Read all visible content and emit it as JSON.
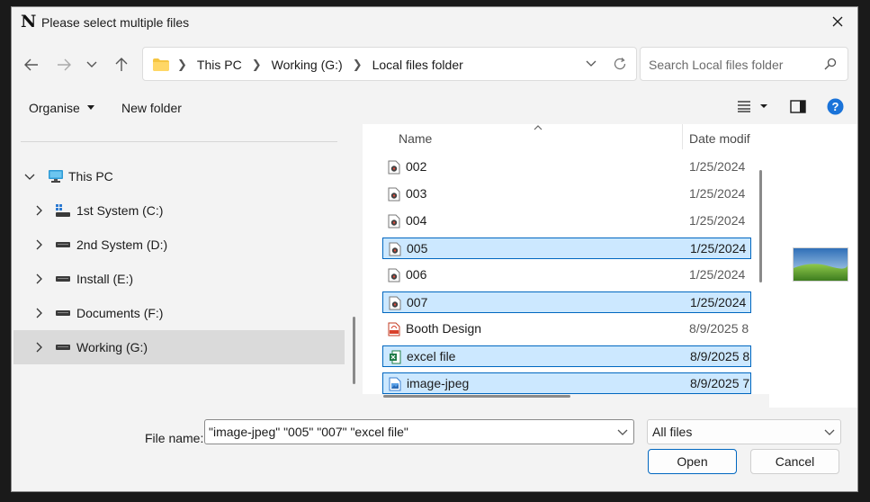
{
  "window": {
    "title": "Please select multiple files",
    "app_icon_glyph": "N"
  },
  "address": {
    "crumbs": [
      "This PC",
      "Working (G:)",
      "Local files folder"
    ]
  },
  "search": {
    "placeholder": "Search Local files folder"
  },
  "toolbar": {
    "organise_label": "Organise",
    "new_folder_label": "New folder",
    "help_glyph": "?"
  },
  "nav": {
    "items": [
      {
        "label": "This PC"
      },
      {
        "label": "1st System (C:)"
      },
      {
        "label": "2nd System (D:)"
      },
      {
        "label": "Install (E:)"
      },
      {
        "label": "Documents (F:)"
      },
      {
        "label": "Working (G:)"
      }
    ]
  },
  "files": {
    "col_name": "Name",
    "col_date": "Date modif",
    "rows": [
      {
        "name": "002",
        "date": "1/25/2024",
        "icon": "video-file-icon",
        "selected": false
      },
      {
        "name": "003",
        "date": "1/25/2024",
        "icon": "video-file-icon",
        "selected": false
      },
      {
        "name": "004",
        "date": "1/25/2024",
        "icon": "video-file-icon",
        "selected": false
      },
      {
        "name": "005",
        "date": "1/25/2024",
        "icon": "video-file-icon",
        "selected": true
      },
      {
        "name": "006",
        "date": "1/25/2024",
        "icon": "video-file-icon",
        "selected": false
      },
      {
        "name": "007",
        "date": "1/25/2024",
        "icon": "video-file-icon",
        "selected": true
      },
      {
        "name": "Booth Design",
        "date": "8/9/2025 8",
        "icon": "pdf-file-icon",
        "selected": false
      },
      {
        "name": "excel file",
        "date": "8/9/2025 8",
        "icon": "excel-file-icon",
        "selected": true
      },
      {
        "name": "image-jpeg",
        "date": "8/9/2025 7",
        "icon": "image-file-icon",
        "selected": true
      }
    ]
  },
  "bottom": {
    "file_name_label": "File name:",
    "file_name_value": "\"image-jpeg\" \"005\" \"007\" \"excel file\"",
    "file_type_value": "All files",
    "open_label": "Open",
    "cancel_label": "Cancel"
  },
  "colors": {
    "accent": "#0067c0",
    "selection": "#cce8ff",
    "folder": "#f5c542"
  }
}
